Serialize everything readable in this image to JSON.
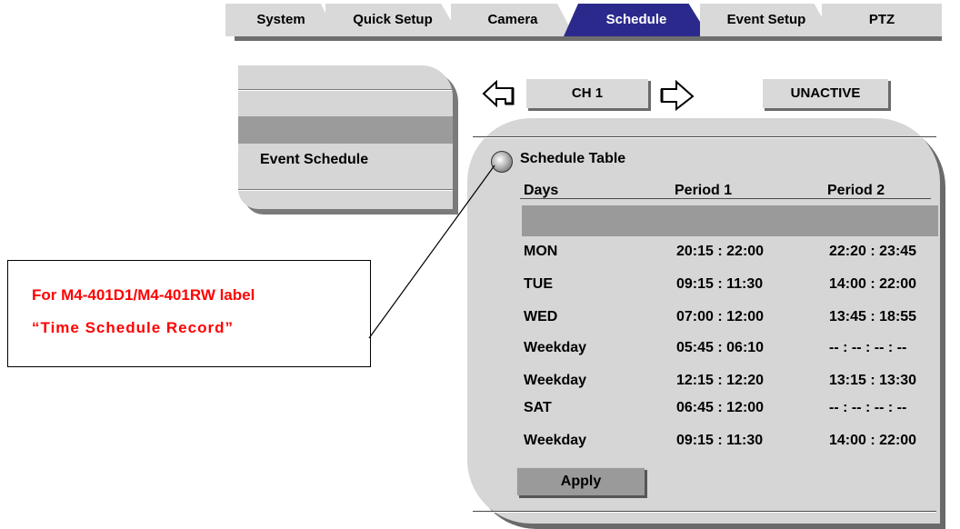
{
  "tabs": [
    {
      "label": "System",
      "active": false
    },
    {
      "label": "Quick Setup",
      "active": false
    },
    {
      "label": "Camera",
      "active": false
    },
    {
      "label": "Schedule",
      "active": true
    },
    {
      "label": "Event Setup",
      "active": false
    },
    {
      "label": "PTZ",
      "active": false
    }
  ],
  "menu": {
    "items": [
      "",
      "",
      "Event Schedule",
      ""
    ]
  },
  "channel": {
    "label": "CH 1",
    "prev_icon": "arrow-left-icon",
    "next_icon": "arrow-right-icon"
  },
  "status_button": {
    "label": "UNACTIVE"
  },
  "schedule": {
    "title": "Schedule Table",
    "headers": {
      "days": "Days",
      "period1": "Period 1",
      "period2": "Period 2"
    },
    "rows": [
      {
        "day": "",
        "p1": "",
        "p2": ""
      },
      {
        "day": "MON",
        "p1": "20:15 : 22:00",
        "p2": "22:20 :  23:45"
      },
      {
        "day": "TUE",
        "p1": "09:15 : 11:30",
        "p2": "14:00 : 22:00"
      },
      {
        "day": "WED",
        "p1": "07:00 : 12:00",
        "p2": "13:45 : 18:55"
      },
      {
        "day": "Weekday",
        "p1": "05:45 : 06:10",
        "p2": "-- : -- :  -- : --"
      },
      {
        "day": "Weekday",
        "p1": "12:15 : 12:20",
        "p2": "13:15 : 13:30"
      },
      {
        "day": "SAT",
        "p1": "06:45 : 12:00",
        "p2": "-- : -- :  -- : --"
      },
      {
        "day": "Weekday",
        "p1": "09:15 : 11:30",
        "p2": "14:00 : 22:00"
      }
    ],
    "apply_label": "Apply"
  },
  "callout": {
    "line1": "For M4-401D1/M4-401RW label",
    "line2": "“Time Schedule Record”",
    "text_color": "#ff0000"
  },
  "colors": {
    "active_tab": "#2b2a8c",
    "panel": "#d6d6d6",
    "selected_row": "#9a9a9a"
  }
}
